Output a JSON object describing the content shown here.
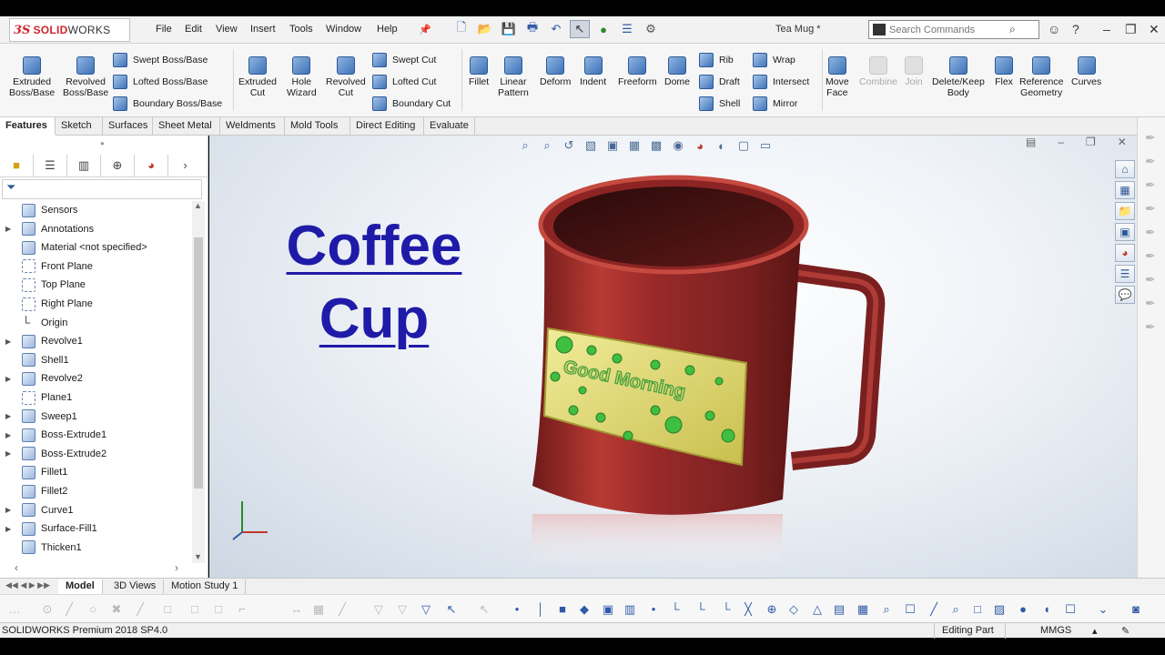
{
  "app": {
    "logo_mark": "3S",
    "logo_name_red": "SOLID",
    "logo_name_dark": "WORKS",
    "menu": [
      "File",
      "Edit",
      "View",
      "Insert",
      "Tools",
      "Window",
      "Help"
    ],
    "document_title": "Tea Mug *",
    "search_placeholder": "Search Commands"
  },
  "command_manager": {
    "big_tools": [
      {
        "label": "Extruded\nBoss/Base",
        "icon": "extruded-boss-icon"
      },
      {
        "label": "Revolved\nBoss/Base",
        "icon": "revolved-boss-icon"
      },
      {
        "label": "Extruded\nCut",
        "icon": "extruded-cut-icon"
      },
      {
        "label": "Hole\nWizard",
        "icon": "hole-wizard-icon"
      },
      {
        "label": "Revolved\nCut",
        "icon": "revolved-cut-icon"
      },
      {
        "label": "Fillet",
        "icon": "fillet-icon"
      },
      {
        "label": "Linear\nPattern",
        "icon": "linear-pattern-icon"
      },
      {
        "label": "Deform",
        "icon": "deform-icon"
      },
      {
        "label": "Indent",
        "icon": "indent-icon"
      },
      {
        "label": "Freeform",
        "icon": "freeform-icon"
      },
      {
        "label": "Dome",
        "icon": "dome-icon"
      },
      {
        "label": "Move\nFace",
        "icon": "move-face-icon"
      },
      {
        "label": "Combine",
        "icon": "combine-icon",
        "disabled": true
      },
      {
        "label": "Join",
        "icon": "join-icon",
        "disabled": true
      },
      {
        "label": "Delete/Keep\nBody",
        "icon": "delete-keep-body-icon"
      },
      {
        "label": "Flex",
        "icon": "flex-icon"
      },
      {
        "label": "Reference\nGeometry",
        "icon": "reference-geometry-icon"
      },
      {
        "label": "Curves",
        "icon": "curves-icon"
      }
    ],
    "small_tools": {
      "swept_boss": "Swept Boss/Base",
      "lofted_boss": "Lofted Boss/Base",
      "boundary_boss": "Boundary Boss/Base",
      "swept_cut": "Swept Cut",
      "lofted_cut": "Lofted Cut",
      "boundary_cut": "Boundary Cut",
      "rib": "Rib",
      "draft": "Draft",
      "shell": "Shell",
      "wrap": "Wrap",
      "intersect": "Intersect",
      "mirror": "Mirror"
    }
  },
  "tabs": [
    "Features",
    "Sketch",
    "Surfaces",
    "Sheet Metal",
    "Weldments",
    "Mold Tools",
    "Direct Editing",
    "Evaluate"
  ],
  "active_tab": "Features",
  "feature_tree": [
    {
      "label": "Sensors",
      "expand": false,
      "icon": "sensors-icon"
    },
    {
      "label": "Annotations",
      "expand": true,
      "icon": "annotations-icon"
    },
    {
      "label": "Material <not specified>",
      "expand": false,
      "icon": "material-icon"
    },
    {
      "label": "Front Plane",
      "expand": false,
      "icon": "plane-icon"
    },
    {
      "label": "Top Plane",
      "expand": false,
      "icon": "plane-icon"
    },
    {
      "label": "Right Plane",
      "expand": false,
      "icon": "plane-icon"
    },
    {
      "label": "Origin",
      "expand": false,
      "icon": "origin-icon"
    },
    {
      "label": "Revolve1",
      "expand": true,
      "icon": "revolve-icon"
    },
    {
      "label": "Shell1",
      "expand": false,
      "icon": "shell-icon"
    },
    {
      "label": "Revolve2",
      "expand": true,
      "icon": "revolve-icon"
    },
    {
      "label": "Plane1",
      "expand": false,
      "icon": "plane-icon"
    },
    {
      "label": "Sweep1",
      "expand": true,
      "icon": "sweep-icon"
    },
    {
      "label": "Boss-Extrude1",
      "expand": true,
      "icon": "boss-extrude-icon"
    },
    {
      "label": "Boss-Extrude2",
      "expand": true,
      "icon": "boss-extrude-icon"
    },
    {
      "label": "Fillet1",
      "expand": false,
      "icon": "fillet-icon"
    },
    {
      "label": "Fillet2",
      "expand": false,
      "icon": "fillet-icon"
    },
    {
      "label": "Curve1",
      "expand": true,
      "icon": "curve-icon"
    },
    {
      "label": "Surface-Fill1",
      "expand": true,
      "icon": "surface-fill-icon"
    },
    {
      "label": "Thicken1",
      "expand": false,
      "icon": "thicken-icon"
    }
  ],
  "viewport": {
    "overlay_title_line1": "Coffee",
    "overlay_title_line2": "Cup",
    "mug_label_text": "Good Morning",
    "colors": {
      "mug": "#9a2a2a",
      "label": "#e9e27a",
      "dots": "#3fbf3f",
      "title": "#1f1ba8"
    }
  },
  "bottom_tabs": [
    "Model",
    "3D Views",
    "Motion Study 1"
  ],
  "active_bottom_tab": "Model",
  "status": {
    "version": "SOLIDWORKS Premium 2018 SP4.0",
    "mode": "Editing Part",
    "units": "MMGS"
  }
}
